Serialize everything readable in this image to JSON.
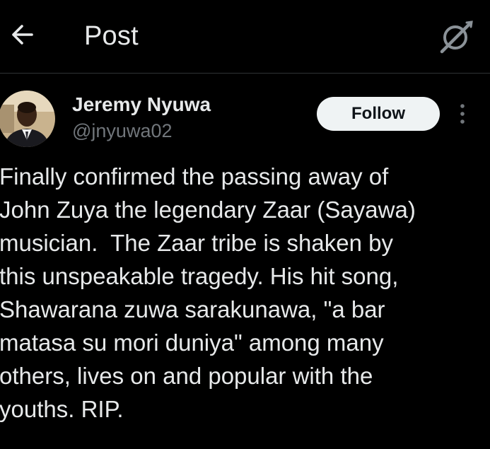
{
  "header": {
    "back_icon": "arrow-left-icon",
    "title": "Post",
    "grok_icon": "grok-icon"
  },
  "author": {
    "name": "Jeremy Nyuwa",
    "handle": "@jnyuwa02",
    "avatar_icon": "avatar-photo"
  },
  "actions": {
    "follow_label": "Follow",
    "more_icon": "more-vertical-icon"
  },
  "post": {
    "text": "Finally confirmed the passing away of\nJohn Zuya the legendary Zaar (Sayawa)\nmusician.  The Zaar tribe is shaken by\nthis unspeakable tragedy. His hit song,\nShawarana zuwa sarakunawa, \"a bar\nmatasa su mori duniya\" among many\nothers, lives on and popular with the\nyouths. RIP."
  },
  "colors": {
    "background": "#000000",
    "text_primary": "#e7e9ea",
    "text_secondary": "#71767b",
    "follow_bg": "#eff3f4",
    "follow_text": "#0f1419",
    "divider": "#2f3336"
  }
}
